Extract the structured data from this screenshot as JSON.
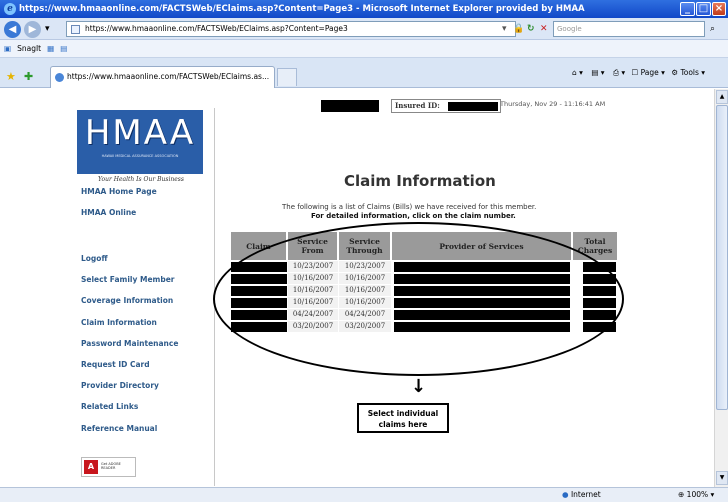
{
  "window": {
    "title": "https://www.hmaaonline.com/FACTSWeb/EClaims.asp?Content=Page3 - Microsoft Internet Explorer provided by HMAA"
  },
  "address_bar": {
    "url": "https://www.hmaaonline.com/FACTSWeb/EClaims.asp?Content=Page3",
    "search_placeholder": "Google"
  },
  "toolbar": {
    "snagit_label": "SnagIt"
  },
  "tabs": [
    {
      "label": "https://www.hmaaonline.com/FACTSWeb/EClaims.as..."
    }
  ],
  "page_tools": {
    "page_label": "Page",
    "tools_label": "Tools"
  },
  "page": {
    "datetime": "Thursday, Nov 29 - 11:16:41 AM",
    "logo_text": "HMAA",
    "logo_subtitle": "HAWAII MEDICAL ASSURANCE ASSOCIATION",
    "slogan": "Your Health Is Our Business",
    "insured_label": "Insured ID:",
    "title": "Claim Information",
    "intro_line1": "The following is a list of Claims (Bills) we have received for this member.",
    "intro_line2": "For detailed information, click on the claim number.",
    "callout": "Select individual claims here"
  },
  "nav": [
    {
      "label": "HMAA Home Page"
    },
    {
      "label": "HMAA Online"
    },
    {
      "label": "Logoff"
    },
    {
      "label": "Select Family Member"
    },
    {
      "label": "Coverage Information"
    },
    {
      "label": "Claim Information"
    },
    {
      "label": "Password Maintenance"
    },
    {
      "label": "Request ID Card"
    },
    {
      "label": "Provider Directory"
    },
    {
      "label": "Related Links"
    },
    {
      "label": "Reference Manual"
    }
  ],
  "adobe": {
    "label": "Get ADOBE READER"
  },
  "table": {
    "headers": {
      "claim": "Claim",
      "service_from": "Service From",
      "service_through": "Service Through",
      "provider": "Provider of Services",
      "total_charges": "Total Charges"
    },
    "rows": [
      {
        "from": "10/23/2007",
        "through": "10/23/2007"
      },
      {
        "from": "10/16/2007",
        "through": "10/16/2007"
      },
      {
        "from": "10/16/2007",
        "through": "10/16/2007"
      },
      {
        "from": "10/16/2007",
        "through": "10/16/2007"
      },
      {
        "from": "04/24/2007",
        "through": "04/24/2007"
      },
      {
        "from": "03/20/2007",
        "through": "03/20/2007"
      }
    ]
  },
  "status_bar": {
    "zone": "Internet",
    "zoom": "100%"
  }
}
